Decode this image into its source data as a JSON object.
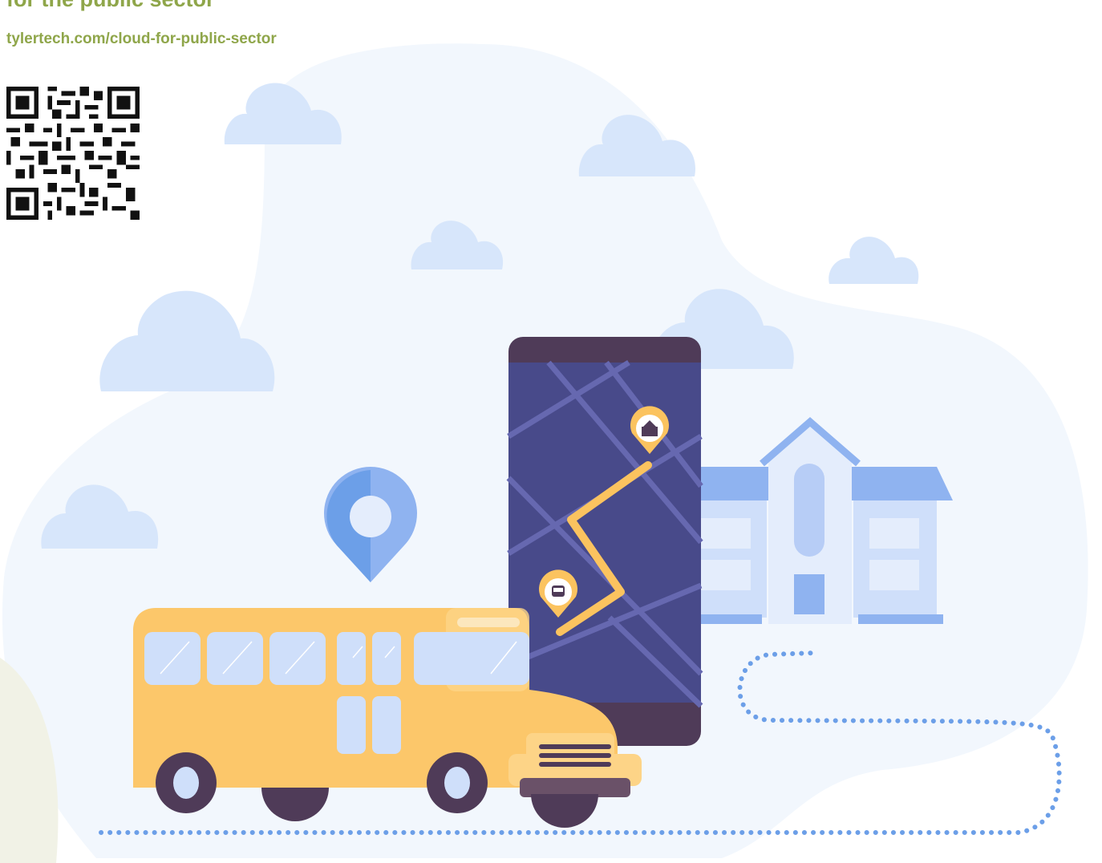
{
  "header": {
    "headline": "for the public sector",
    "url": "tylertech.com/cloud-for-public-sector"
  },
  "icons": {
    "qr": "qr-code",
    "map_pin": "map-pin-icon",
    "school_pin": "school-icon",
    "bus_pin": "bus-icon"
  },
  "colors": {
    "brand_green": "#8fa64a",
    "sky": "#f2f7fd",
    "cloud": "#d7e6fb",
    "phone_screen": "#484a8a",
    "route": "#fbc35f",
    "bus": "#fcc76a"
  }
}
